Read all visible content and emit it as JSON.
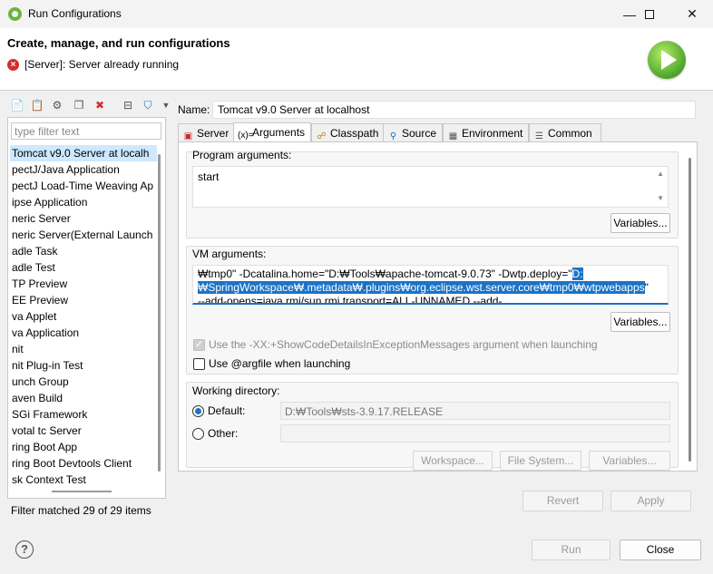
{
  "window": {
    "title": "Run Configurations",
    "minimize": "—",
    "maximize": "☐",
    "close": "✕"
  },
  "header": {
    "title": "Create, manage, and run configurations",
    "message": "[Server]: Server already running"
  },
  "left": {
    "filter_placeholder": "type filter text",
    "items": [
      "Tomcat v9.0 Server at localh",
      "pectJ/Java Application",
      "pectJ Load-Time Weaving Ap",
      "ipse Application",
      "neric Server",
      "neric Server(External Launch",
      "adle Task",
      "adle Test",
      "TP Preview",
      "EE Preview",
      "va Applet",
      "va Application",
      "nit",
      "nit Plug-in Test",
      "unch Group",
      "aven Build",
      "SGi Framework",
      "votal tc Server",
      "ring Boot App",
      "ring Boot Devtools Client",
      "sk Context Test"
    ],
    "status": "Filter matched 29 of 29 items"
  },
  "right": {
    "name_label": "Name:",
    "name_value": "Tomcat v9.0 Server at localhost",
    "tabs": [
      "Server",
      "Arguments",
      "Classpath",
      "Source",
      "Environment",
      "Common"
    ],
    "program_args_label": "Program arguments:",
    "program_args_value": "start",
    "variables_label": "Variables...",
    "vm_args_label": "VM arguments:",
    "vm_line1_plain": "₩tmp0\" -Dcatalina.home=\"D:₩Tools₩apache-tomcat-9.0.73\" -Dwtp.deploy=\"",
    "vm_line1_sel": "D:",
    "vm_line2_sel": "₩SpringWorkspace₩.metadata₩.plugins₩org.eclipse.wst.server.core₩tmp0₩wtpwebapps",
    "vm_line2_plain": "\"",
    "vm_line3": "--add-opens=java.rmi/sun.rmi.transport=ALL-UNNAMED --add-",
    "showcode_label": "Use the -XX:+ShowCodeDetailsInExceptionMessages argument when launching",
    "argfile_label": "Use @argfile when launching",
    "workdir_label": "Working directory:",
    "default_label": "Default:",
    "default_value": "D:₩Tools₩sts-3.9.17.RELEASE",
    "other_label": "Other:",
    "workspace_btn": "Workspace...",
    "filesystem_btn": "File System...",
    "variables_btn3": "Variables..."
  },
  "footer": {
    "revert": "Revert",
    "apply": "Apply",
    "run": "Run",
    "close": "Close",
    "help": "?"
  }
}
